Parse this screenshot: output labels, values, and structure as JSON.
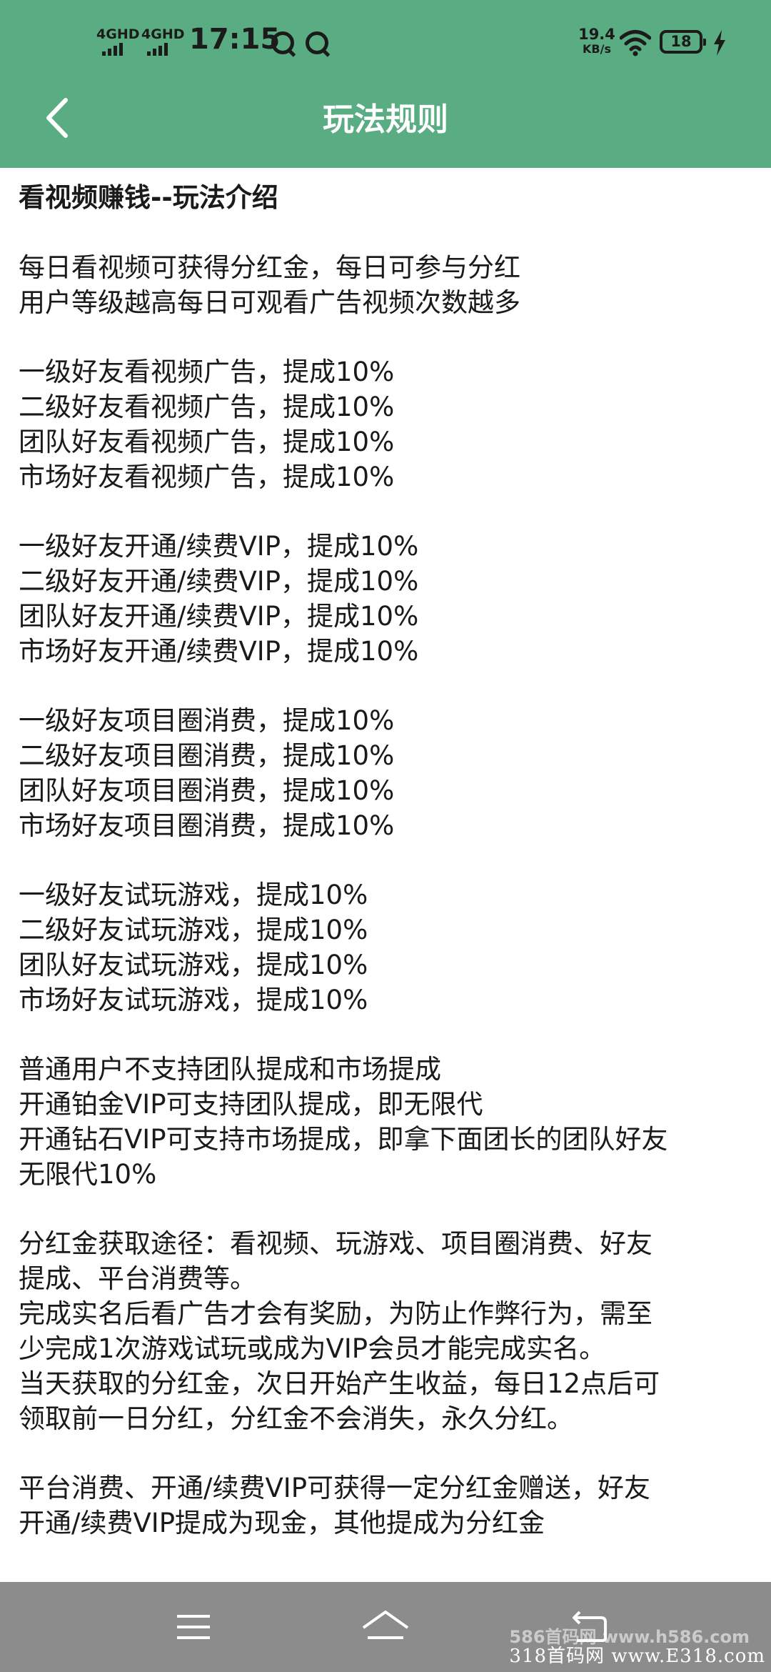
{
  "status_bar": {
    "signal_1": "4GHD",
    "signal_2": "4GHD",
    "time": "17:15",
    "net_speed_value": "19.4",
    "net_speed_unit": "KB/s",
    "battery": "18"
  },
  "header": {
    "title": "玩法规则",
    "background_color": "#5aad82"
  },
  "content": {
    "title": "看视频赚钱--玩法介绍",
    "paragraphs": [
      [
        "每日看视频可获得分红金，每日可参与分红",
        "用户等级越高每日可观看广告视频次数越多"
      ],
      [
        "一级好友看视频广告，提成10%",
        "二级好友看视频广告，提成10%",
        "团队好友看视频广告，提成10%",
        "市场好友看视频广告，提成10%"
      ],
      [
        "一级好友开通/续费VIP，提成10%",
        "二级好友开通/续费VIP，提成10%",
        "团队好友开通/续费VIP，提成10%",
        "市场好友开通/续费VIP，提成10%"
      ],
      [
        "一级好友项目圈消费，提成10%",
        "二级好友项目圈消费，提成10%",
        "团队好友项目圈消费，提成10%",
        "市场好友项目圈消费，提成10%"
      ],
      [
        "一级好友试玩游戏，提成10%",
        "二级好友试玩游戏，提成10%",
        "团队好友试玩游戏，提成10%",
        "市场好友试玩游戏，提成10%"
      ],
      [
        "普通用户不支持团队提成和市场提成",
        "开通铂金VIP可支持团队提成，即无限代",
        "开通钻石VIP可支持市场提成，即拿下面团长的团队好友",
        "无限代10%"
      ],
      [
        "分红金获取途径：看视频、玩游戏、项目圈消费、好友",
        "提成、平台消费等。",
        "完成实名后看广告才会有奖励，为防止作弊行为，需至",
        "少完成1次游戏试玩或成为VIP会员才能完成实名。",
        "当天获取的分红金，次日开始产生收益，每日12点后可",
        "领取前一日分红，分红金不会消失，永久分红。"
      ],
      [
        "平台消费、开通/续费VIP可获得一定分红金赠送，好友",
        "开通/续费VIP提成为现金，其他提成为分红金"
      ]
    ]
  },
  "nav": {
    "icons": [
      "menu-icon",
      "home-icon",
      "back-icon"
    ]
  },
  "watermark": {
    "line1": "586首码网 www.h586.com",
    "line2": "318首码网 www.E318.com"
  }
}
